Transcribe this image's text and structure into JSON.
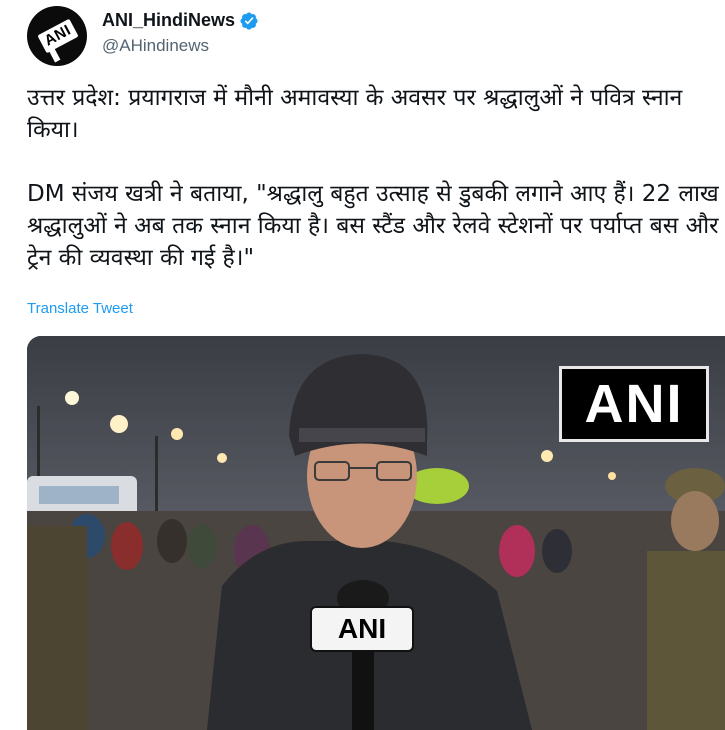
{
  "author": {
    "display_name": "ANI_HindiNews",
    "handle": "@AHindinews",
    "avatar_text": "ANI",
    "verified": true
  },
  "tweet": {
    "text": "उत्तर प्रदेश: प्रयागराज में मौनी अमावस्या के अवसर पर श्रद्धालुओं ने पवित्र स्नान किया।\n\nDM संजय खत्री ने बताया, \"श्रद्धालु बहुत उत्साह से डुबकी लगाने आए हैं। 22 लाख श्रद्धालुओं ने अब तक स्नान किया है। बस स्टैंड और रेलवे स्टेशनों पर पर्याप्त बस और ट्रेन की व्यवस्था की गई है।\"",
    "translate_label": "Translate Tweet"
  },
  "media": {
    "watermark": "ANI",
    "mic_flag": "ANI"
  },
  "colors": {
    "link": "#1d9bf0",
    "verified": "#1d9bf0",
    "secondary_text": "#536471"
  },
  "icons": {
    "verified": "verified-badge-icon"
  }
}
